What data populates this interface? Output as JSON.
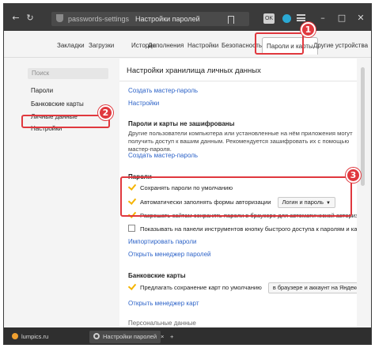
{
  "browser": {
    "url": "passwords-settings",
    "page_title": "Настройки паролей",
    "ext_badge": "OK"
  },
  "settings_tabs": [
    "Закладки",
    "Загрузки",
    "История",
    "Дополнения",
    "Настройки",
    "Безопасность",
    "Пароли и карты",
    "Другие устройства"
  ],
  "sidebar": {
    "search_placeholder": "Поиск",
    "items": [
      "Пароли",
      "Банковские карты",
      "Личные данные",
      "Настройки"
    ]
  },
  "main": {
    "title": "Настройки хранилища личных данных",
    "create_master_link": "Создать мастер-пароль",
    "settings_link": "Настройки",
    "unencrypted_heading": "Пароли и карты не зашифрованы",
    "unencrypted_text": "Другие пользователи компьютера или установленные на нём приложения могут получить доступ к вашим данным. Рекомендуется зашифровать их с помощью мастер-пароля.",
    "create_master_link2": "Создать мастер-пароль",
    "passwords_heading": "Пароли",
    "save_by_default": "Сохранять пароли по умолчанию",
    "autofill": "Автоматически заполнять формы авторизации",
    "autofill_option": "Логин и пароль",
    "allow_sites": "Разрешать сайтам сохранять пароли в браузере для автоматической авторизации",
    "show_button": "Показывать на панели инструментов кнопку быстрого доступа к паролям и картам",
    "import_link": "Импортировать пароли",
    "open_manager_link": "Открыть менеджер паролей",
    "cards_heading": "Банковские карты",
    "offer_save_cards": "Предлагать сохранение карт по умолчанию",
    "cards_option": "в браузере и аккаунт на Яндексе",
    "open_cards_link": "Открыть менеджер карт",
    "cut_text": "Персональные данные"
  },
  "annotations": [
    "1",
    "2",
    "3"
  ],
  "bottom_tabs": {
    "tab1": "lumpics.ru",
    "tab2": "Настройки паролей",
    "close": "×",
    "add": "+"
  },
  "colors": {
    "annotation_red": "#e0383e",
    "link_blue": "#2d63c8",
    "check_yellow": "#f5b400"
  }
}
